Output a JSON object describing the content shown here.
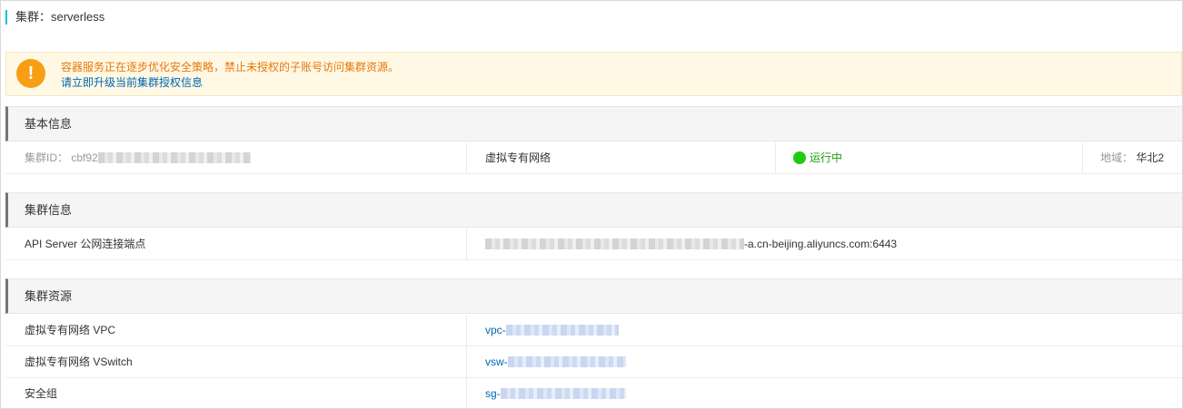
{
  "page": {
    "title": "集群：serverless"
  },
  "notice": {
    "message": "容器服务正在逐步优化安全策略，禁止未授权的子账号访问集群资源。",
    "link_text": "请立即升级当前集群授权信息"
  },
  "basic_info": {
    "heading": "基本信息",
    "cluster_id_label": "集群ID：",
    "cluster_id_value": "cbf92",
    "network_type": "虚拟专有网络",
    "status": "运行中",
    "region_label": "地域：",
    "region_value": "华北2"
  },
  "cluster_info": {
    "heading": "集群信息",
    "api_server_label": "API Server 公网连接端点",
    "api_server_suffix": "-a.cn-beijing.aliyuncs.com:6443"
  },
  "cluster_resources": {
    "heading": "集群资源",
    "rows": [
      {
        "label": "虚拟专有网络 VPC",
        "value_prefix": "vpc-"
      },
      {
        "label": "虚拟专有网络 VSwitch",
        "value_prefix": "vsw-"
      },
      {
        "label": "安全组",
        "value_prefix": "sg-"
      }
    ]
  },
  "colors": {
    "accent": "#00c1de",
    "warning": "#f79e15",
    "link": "#0066b0",
    "status_green": "#1ecb10"
  }
}
